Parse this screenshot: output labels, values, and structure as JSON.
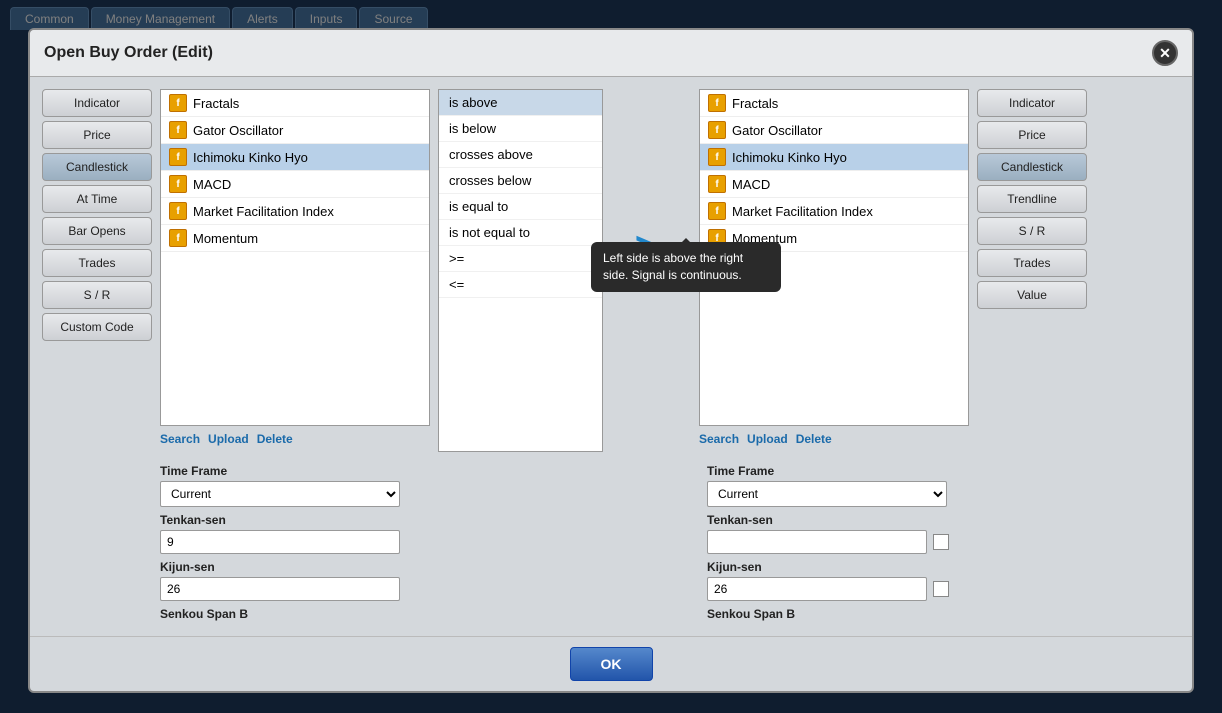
{
  "modal": {
    "title": "Open Buy Order (Edit)",
    "close_label": "✕",
    "ok_label": "OK"
  },
  "tabs": {
    "items": [
      "Common",
      "Money Management",
      "Alerts",
      "Inputs",
      "Source"
    ]
  },
  "left_sidebar": {
    "buttons": [
      {
        "label": "Indicator",
        "active": false
      },
      {
        "label": "Price",
        "active": false
      },
      {
        "label": "Candlestick",
        "active": true
      },
      {
        "label": "At Time",
        "active": false
      },
      {
        "label": "Bar Opens",
        "active": false
      },
      {
        "label": "Trades",
        "active": false
      },
      {
        "label": "S / R",
        "active": false
      },
      {
        "label": "Custom Code",
        "active": false
      }
    ]
  },
  "right_sidebar": {
    "buttons": [
      {
        "label": "Indicator",
        "active": false
      },
      {
        "label": "Price",
        "active": false
      },
      {
        "label": "Candlestick",
        "active": true
      },
      {
        "label": "Trendline",
        "active": false
      },
      {
        "label": "S / R",
        "active": false
      },
      {
        "label": "Trades",
        "active": false
      },
      {
        "label": "Value",
        "active": false
      }
    ]
  },
  "left_indicator_list": {
    "items": [
      {
        "name": "Fractals",
        "selected": false
      },
      {
        "name": "Gator Oscillator",
        "selected": false
      },
      {
        "name": "Ichimoku Kinko Hyo",
        "selected": true
      },
      {
        "name": "MACD",
        "selected": false
      },
      {
        "name": "Market Facilitation Index",
        "selected": false
      },
      {
        "name": "Momentum",
        "selected": false
      }
    ],
    "actions": {
      "search": "Search",
      "upload": "Upload",
      "delete": "Delete"
    }
  },
  "right_indicator_list": {
    "items": [
      {
        "name": "Fractals",
        "selected": false
      },
      {
        "name": "Gator Oscillator",
        "selected": false
      },
      {
        "name": "Ichimoku Kinko Hyo",
        "selected": true
      },
      {
        "name": "MACD",
        "selected": false
      },
      {
        "name": "Market Facilitation Index",
        "selected": false
      },
      {
        "name": "Momentum",
        "selected": false
      }
    ],
    "actions": {
      "search": "Search",
      "upload": "Upload",
      "delete": "Delete"
    }
  },
  "condition_list": {
    "items": [
      {
        "label": "is above",
        "selected": true
      },
      {
        "label": "is below",
        "selected": false
      },
      {
        "label": "crosses above",
        "selected": false
      },
      {
        "label": "crosses below",
        "selected": false
      },
      {
        "label": "is equal to",
        "selected": false
      },
      {
        "label": "is not equal to",
        "selected": false
      },
      {
        "label": ">=",
        "selected": false
      },
      {
        "label": "<=",
        "selected": false
      }
    ]
  },
  "arrow": {
    "symbol": ">"
  },
  "tooltip": {
    "text": "Left side is above the right side. Signal is continuous."
  },
  "left_params": {
    "timeframe_label": "Time Frame",
    "timeframe_value": "Current",
    "tenkan_label": "Tenkan-sen",
    "tenkan_value": "9",
    "kijun_label": "Kijun-sen",
    "kijun_value": "26",
    "senkou_label": "Senkou Span B"
  },
  "right_params": {
    "timeframe_label": "Time Frame",
    "timeframe_value": "Current",
    "tenkan_label": "Tenkan-sen",
    "tenkan_value": "",
    "kijun_label": "Kijun-sen",
    "kijun_value": "26",
    "senkou_label": "Senkou Span B"
  },
  "icon_label": "f"
}
